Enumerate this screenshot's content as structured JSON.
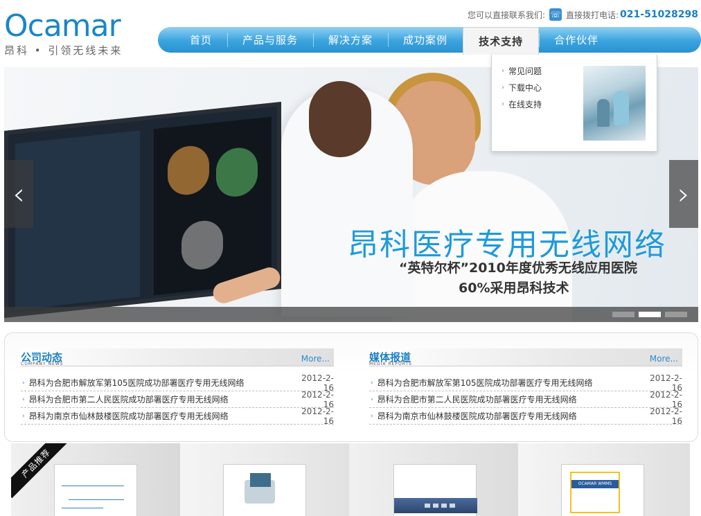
{
  "header": {
    "logo_word": "Ocamar",
    "logo_slogan": "昂科 • 引领无线未来",
    "contact_label": "您可以直接联系我们:",
    "phone_label": "直接拨打电话:",
    "phone_number": "021-51028298",
    "phone_icon": "phone-icon"
  },
  "nav": {
    "items": [
      {
        "label": "首页"
      },
      {
        "label": "产品与服务"
      },
      {
        "label": "解决方案"
      },
      {
        "label": "成功案例"
      },
      {
        "label": "技术支持"
      },
      {
        "label": "合作伙伴"
      }
    ],
    "active_index": 4
  },
  "dropdown": {
    "items": [
      {
        "label": "常见问题"
      },
      {
        "label": "下载中心"
      },
      {
        "label": "在线支持"
      }
    ]
  },
  "banner": {
    "title": "昂科医疗专用无线网络",
    "subtitle_1": "“英特尔杯”2010年度优秀无线应用医院",
    "subtitle_2": "60%采用昂科技术",
    "prev_icon": "chevron-left-icon",
    "next_icon": "chevron-right-icon",
    "prev_glyph": "‹",
    "next_glyph": "›",
    "slide_count": 3,
    "active_slide": 2
  },
  "news": {
    "company": {
      "title": "公司动态",
      "subtitle": "COMPANY NEWS",
      "more": "More...",
      "items": [
        {
          "text": "昂科为合肥市解放军第105医院成功部署医疗专用无线网络",
          "date": "2012-2-16"
        },
        {
          "text": "昂科为合肥市第二人民医院成功部署医疗专用无线网络",
          "date": "2012-2-16"
        },
        {
          "text": "昂科为南京市仙林鼓楼医院成功部署医疗专用无线网络",
          "date": "2012-2-16"
        }
      ]
    },
    "media": {
      "title": "媒体报道",
      "subtitle": "MEDIA REPORTS",
      "more": "More...",
      "items": [
        {
          "text": "昂科为合肥市解放军第105医院成功部署医疗专用无线网络",
          "date": "2012-2-16"
        },
        {
          "text": "昂科为合肥市第二人民医院成功部署医疗专用无线网络",
          "date": "2012-2-16"
        },
        {
          "text": "昂科为南京市仙林鼓楼医院成功部署医疗专用无线网络",
          "date": "2012-2-16"
        }
      ]
    }
  },
  "products": {
    "ribbon": "产品推荐",
    "package_label": "OCAMAR WMMS"
  },
  "colors": {
    "brand_blue": "#1a86c8",
    "nav_blue": "#3aa3de",
    "link_blue": "#2a8ad2"
  }
}
